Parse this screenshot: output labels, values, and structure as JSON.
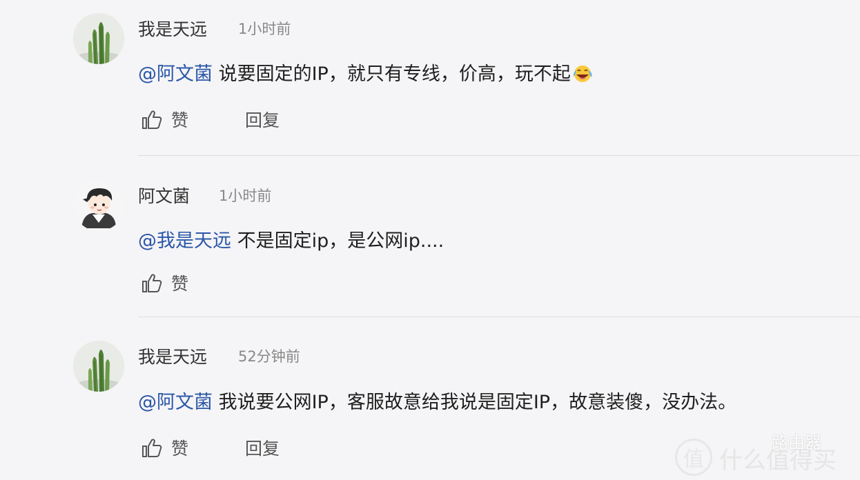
{
  "comments": [
    {
      "username": "我是天远",
      "time": "1小时前",
      "mention": "@阿文菌",
      "text": "说要固定的IP，就只有专线，价高，玩不起",
      "emoji": "laughing-crying-emoji",
      "like_label": "赞",
      "reply_label": "回复",
      "avatar": "cactus-avatar"
    },
    {
      "username": "阿文菌",
      "time": "1小时前",
      "mention": "@我是天远",
      "text": "不是固定ip，是公网ip....",
      "like_label": "赞",
      "avatar": "cartoon-boy-avatar"
    },
    {
      "username": "我是天远",
      "time": "52分钟前",
      "mention": "@阿文菌",
      "text": "我说要公网IP，客服故意给我说是固定IP，故意装傻，没办法。",
      "like_label": "赞",
      "reply_label": "回复",
      "avatar": "cactus-avatar"
    }
  ],
  "watermark": {
    "badge": "值",
    "text": "什么值得买",
    "sub": "路由器"
  },
  "colors": {
    "background": "#f5f4f6",
    "mention": "#2a57a8",
    "time": "#888888",
    "divider": "#dcdcdf"
  }
}
